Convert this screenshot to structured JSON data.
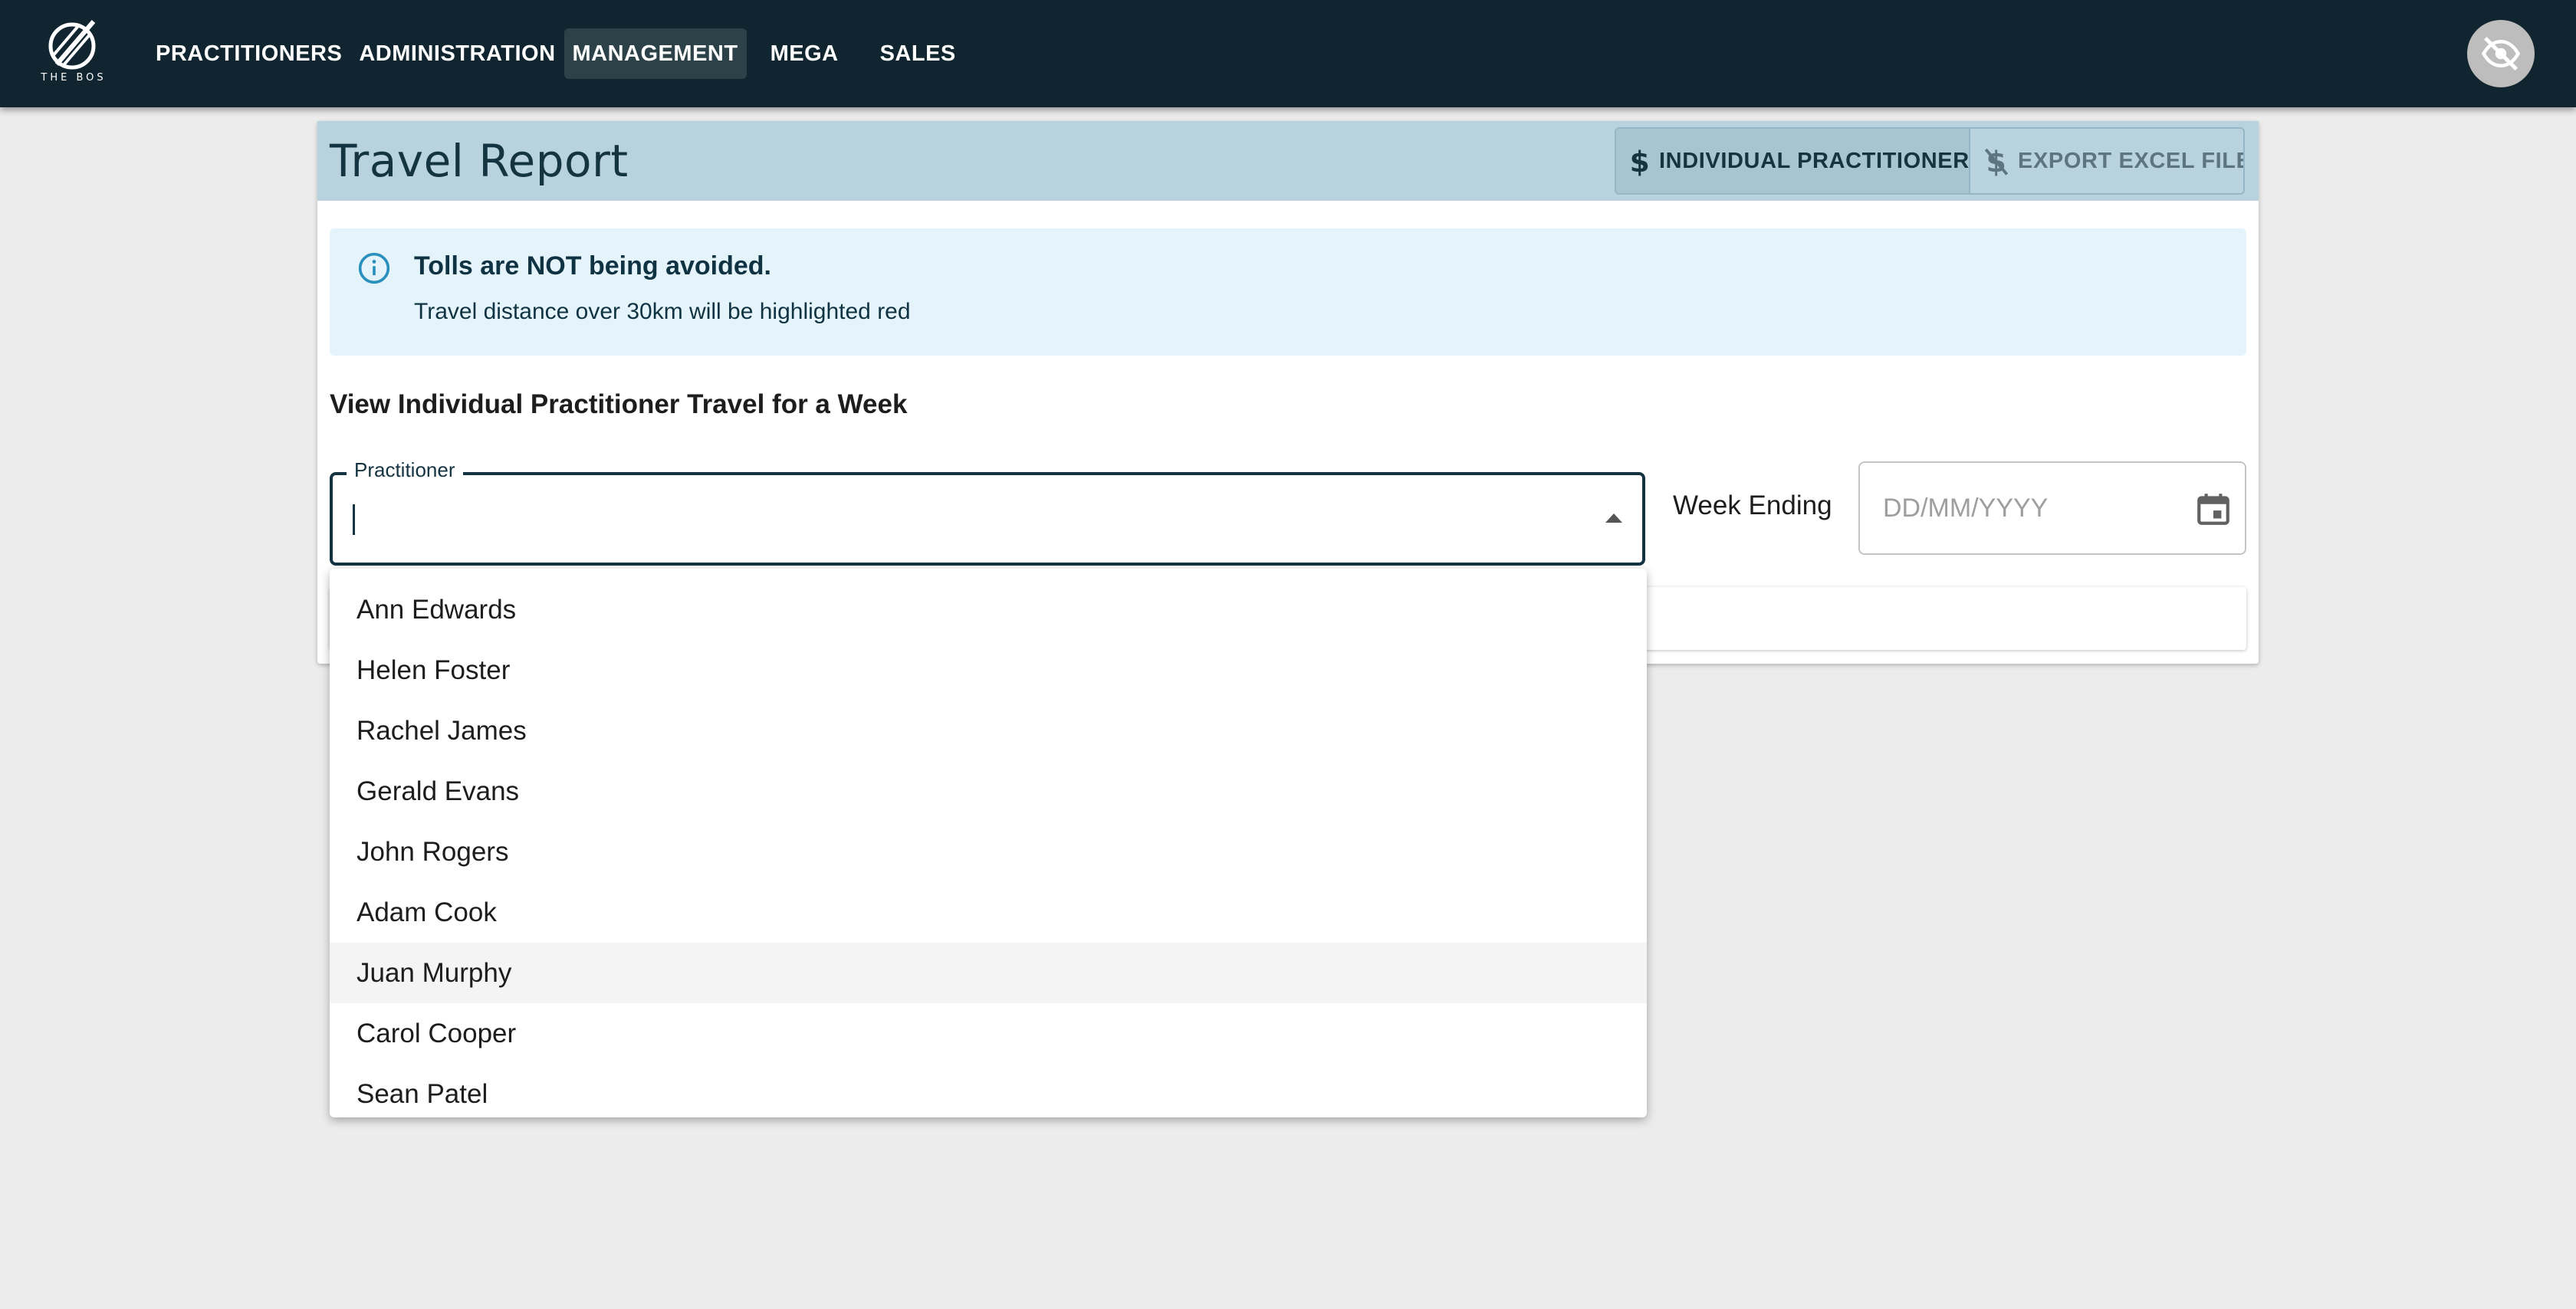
{
  "nav": {
    "logo_text": "THE BOS",
    "items": [
      {
        "label": "PRACTITIONERS",
        "active": false
      },
      {
        "label": "ADMINISTRATION",
        "active": false
      },
      {
        "label": "MANAGEMENT",
        "active": true
      },
      {
        "label": "MEGA",
        "active": false
      },
      {
        "label": "SALES",
        "active": false
      }
    ],
    "avatar_icon": "eye-off-icon"
  },
  "header": {
    "title": "Travel Report",
    "buttons": [
      {
        "label": "INDIVIDUAL PRACTITIONER",
        "icon": "dollar-icon",
        "enabled": true
      },
      {
        "label": "EXPORT EXCEL FILE",
        "icon": "dollar-off-icon",
        "enabled": false
      }
    ]
  },
  "alert": {
    "icon": "info-icon",
    "title": "Tolls are NOT being avoided.",
    "body": "Travel distance over 30km will be highlighted red"
  },
  "section": {
    "title": "View Individual Practitioner Travel for a Week"
  },
  "practitioner_field": {
    "label": "Practitioner",
    "value": ""
  },
  "week_ending": {
    "label": "Week Ending",
    "placeholder": "DD/MM/YYYY",
    "icon": "calendar-icon"
  },
  "options": [
    "Ann Edwards",
    "Helen Foster",
    "Rachel James",
    "Gerald Evans",
    "John Rogers",
    "Adam Cook",
    "Juan Murphy",
    "Carol Cooper",
    "Sean Patel"
  ],
  "colors": {
    "topbar": "#10252f",
    "header_band": "#b9d3de",
    "alert_bg": "#e5f4fa",
    "primary_text": "#143441"
  }
}
